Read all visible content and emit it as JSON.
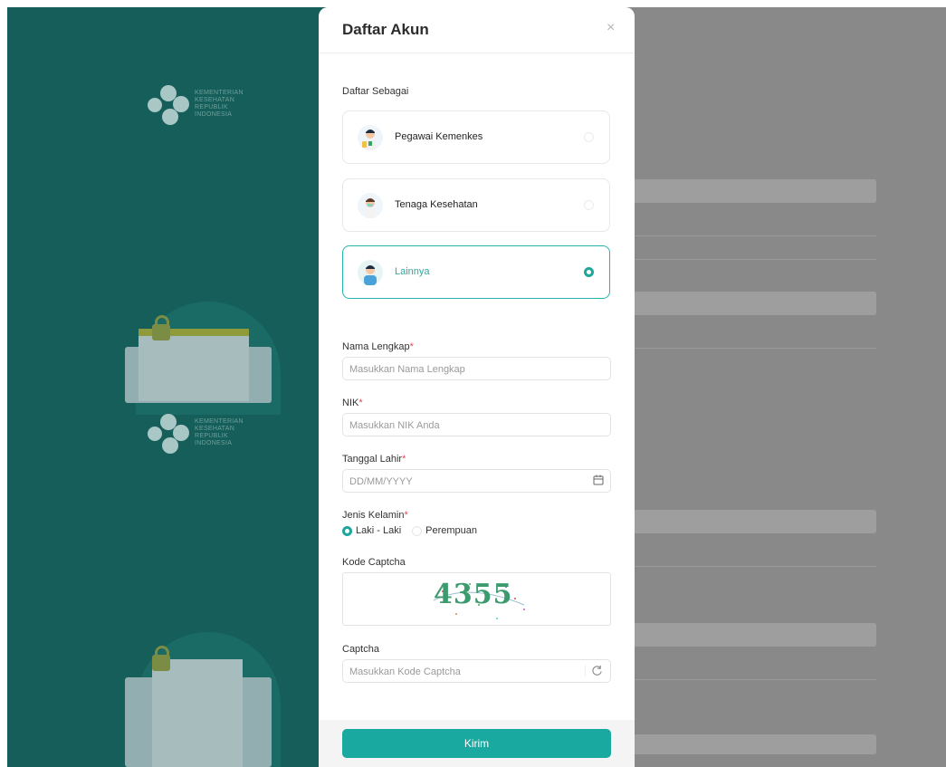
{
  "logo": {
    "lines": [
      "KEMENTERIAN",
      "KESEHATAN",
      "REPUBLIK",
      "INDONESIA"
    ]
  },
  "modal": {
    "title": "Daftar Akun",
    "close": "×",
    "register_as_label": "Daftar Sebagai",
    "options": [
      {
        "label": "Pegawai Kemenkes",
        "selected": false
      },
      {
        "label": "Tenaga Kesehatan",
        "selected": false
      },
      {
        "label": "Lainnya",
        "selected": true
      }
    ],
    "full_name": {
      "label": "Nama Lengkap",
      "placeholder": "Masukkan Nama Lengkap"
    },
    "nik": {
      "label": "NIK",
      "placeholder": "Masukkan NIK Anda"
    },
    "birth_date": {
      "label": "Tanggal Lahir",
      "placeholder": "DD/MM/YYYY"
    },
    "gender": {
      "label": "Jenis Kelamin",
      "options": [
        "Laki - Laki",
        "Perempuan"
      ],
      "selected": "Laki - Laki"
    },
    "captcha_code_label": "Kode Captcha",
    "captcha_image_text": "4355",
    "captcha": {
      "label": "Captcha",
      "placeholder": "Masukkan Kode Captcha"
    },
    "submit_label": "Kirim"
  },
  "required_mark": "*",
  "colors": {
    "accent": "#1aa9a1",
    "left_panel": "#155e5a",
    "required": "#e0465a"
  },
  "icons": {
    "calendar": "calendar-icon",
    "refresh": "refresh-icon",
    "close": "close-icon"
  }
}
